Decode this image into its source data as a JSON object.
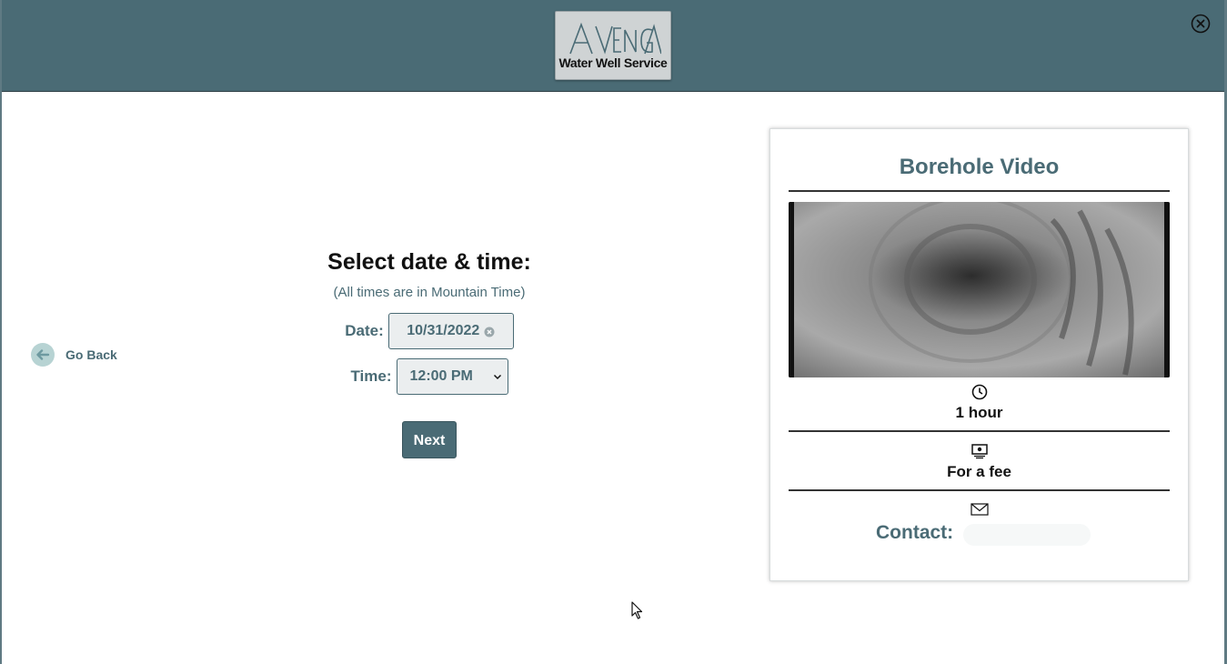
{
  "header": {
    "logo_text": "Water Well Service",
    "logo_mark": "AvenGA",
    "close_icon": "close-circle-icon"
  },
  "nav": {
    "go_back_label": "Go Back",
    "go_back_icon": "arrow-left-icon"
  },
  "form": {
    "title": "Select date & time:",
    "subtitle": "(All times are in Mountain Time)",
    "date_label": "Date:",
    "date_value": "10/31/2022",
    "time_label": "Time:",
    "time_value": "12:00 PM",
    "next_label": "Next"
  },
  "service_card": {
    "title": "Borehole Video",
    "duration": "1 hour",
    "duration_icon": "clock-icon",
    "price": "For a fee",
    "price_icon": "money-icon",
    "contact_label": "Contact:",
    "contact_icon": "envelope-icon"
  },
  "colors": {
    "accent": "#4a6b75",
    "go_back_circle": "#b7d3d3",
    "field_bg": "#ebeeef"
  }
}
